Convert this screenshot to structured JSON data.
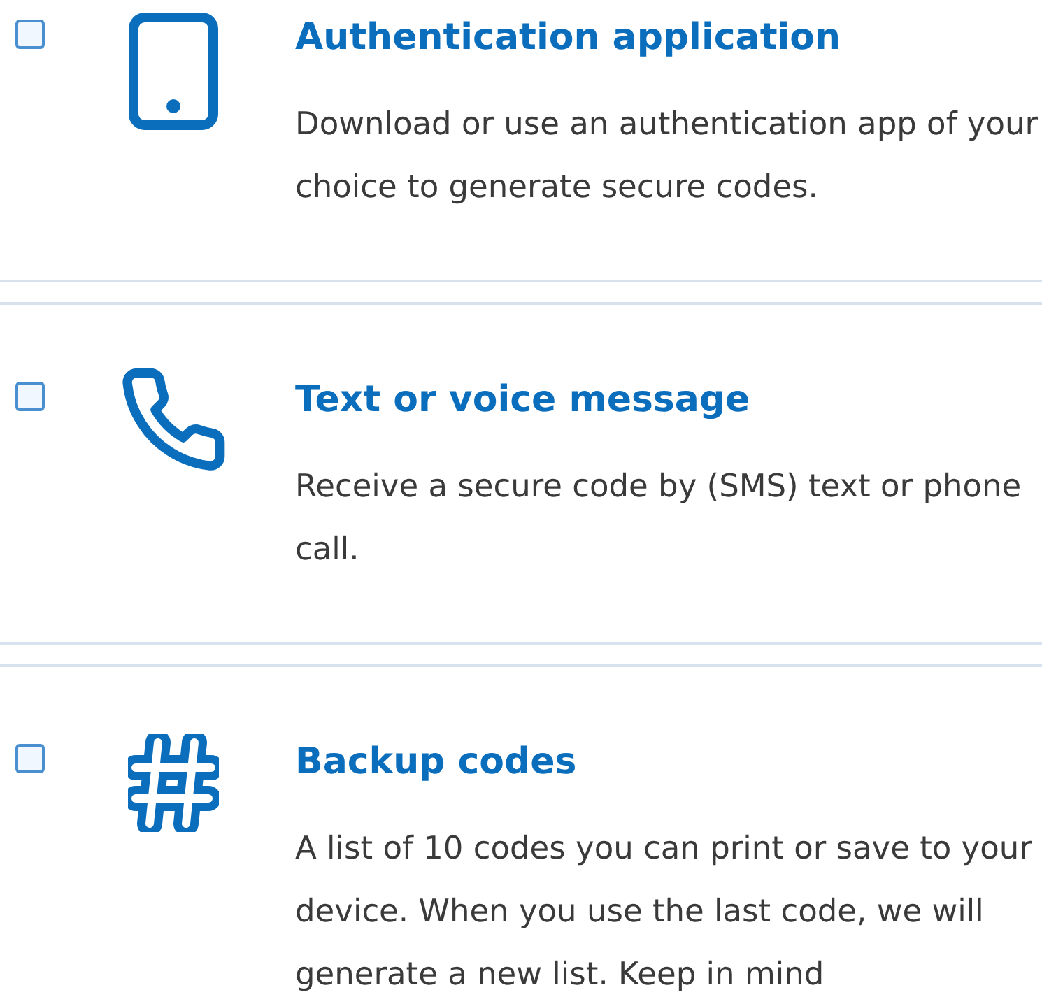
{
  "options": [
    {
      "kind": "mobile",
      "checked": false,
      "title": "Authentication application",
      "description": "Download or use an authentication app of your choice to generate secure codes."
    },
    {
      "kind": "phone",
      "checked": false,
      "title": "Text or voice message",
      "description": "Receive a secure code by (SMS) text or phone call."
    },
    {
      "kind": "hash",
      "checked": false,
      "title": "Backup codes",
      "description": "A list of 10 codes you can print or save to your device. When you use the last code, we will generate a new list. Keep in mind"
    }
  ]
}
